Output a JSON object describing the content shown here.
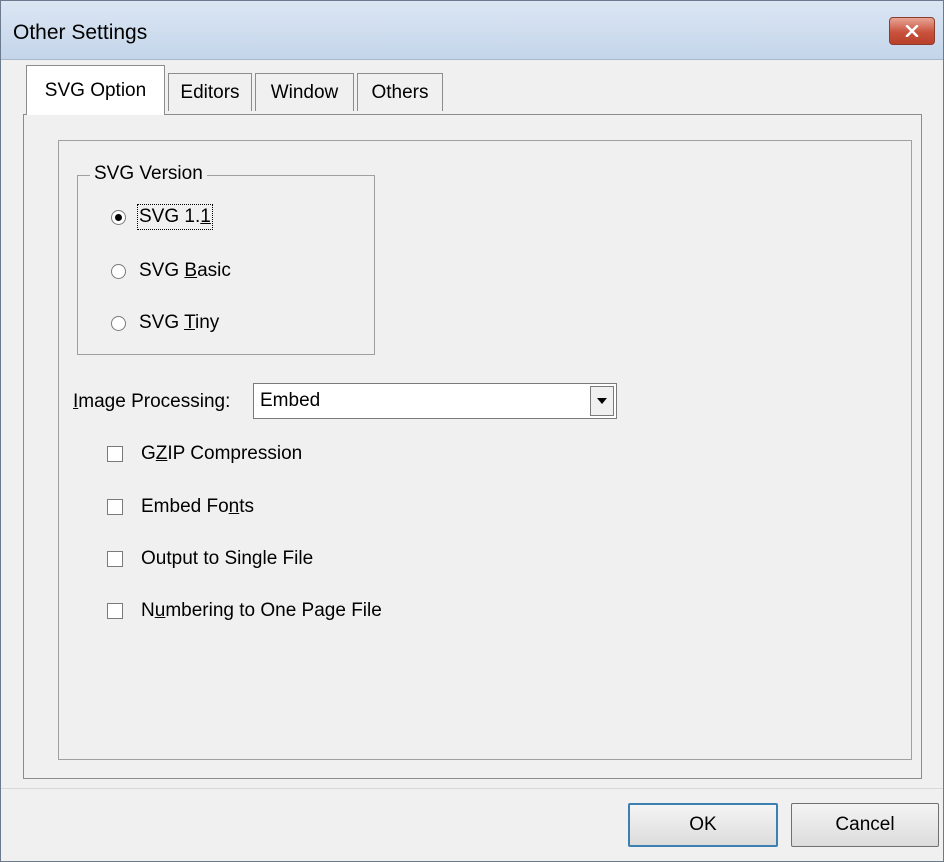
{
  "window": {
    "title": "Other Settings"
  },
  "tabs": [
    {
      "label": "SVG Option",
      "active": true
    },
    {
      "label": "Editors",
      "active": false
    },
    {
      "label": "Window",
      "active": false
    },
    {
      "label": "Others",
      "active": false
    }
  ],
  "svg_version": {
    "legend": "SVG Version",
    "options": [
      {
        "pre": "SVG 1.",
        "mnemonic": "1",
        "post": "",
        "selected": true
      },
      {
        "pre": "SVG ",
        "mnemonic": "B",
        "post": "asic",
        "selected": false
      },
      {
        "pre": "SVG ",
        "mnemonic": "T",
        "post": "iny",
        "selected": false
      }
    ]
  },
  "image_processing": {
    "label_pre": "",
    "label_mnemonic": "I",
    "label_post": "mage Processing:",
    "selected": "Embed"
  },
  "checkboxes": [
    {
      "pre": "G",
      "mnemonic": "Z",
      "post": "IP Compression",
      "checked": false
    },
    {
      "pre": "Embed Fo",
      "mnemonic": "n",
      "post": "ts",
      "checked": false
    },
    {
      "pre": "Output to Sin",
      "mnemonic": "g",
      "post": "le File",
      "checked": false
    },
    {
      "pre": "N",
      "mnemonic": "u",
      "post": "mbering to One Page File",
      "checked": false
    }
  ],
  "buttons": {
    "ok": "OK",
    "cancel": "Cancel"
  },
  "colors": {
    "close_button": "#c9523c",
    "dialog_bg": "#f0f0f0"
  }
}
